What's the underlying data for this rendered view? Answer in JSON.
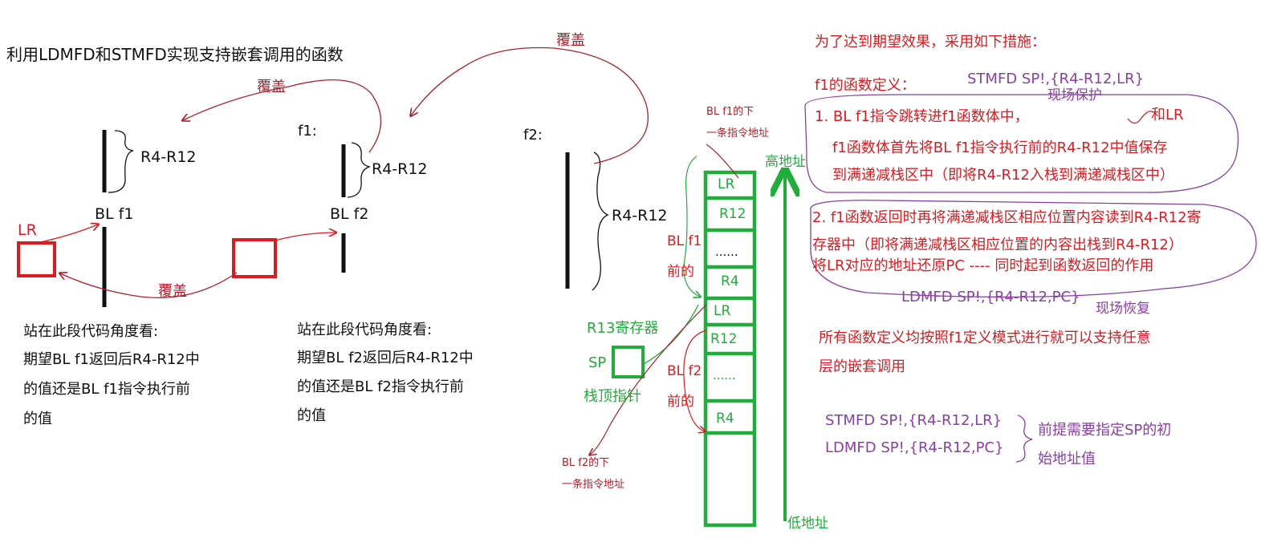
{
  "title": "利用LDMFD和STMFD实现支持嵌套调用的函数",
  "part1": {
    "regs": "R4-R12",
    "call": "BL f1",
    "lr": "LR",
    "cover_top": "覆盖",
    "cover_bottom": "覆盖",
    "note": [
      "站在此段代码角度看:",
      "期望BL f1返回后R4-R12中",
      "的值还是BL f1指令执行前",
      "的值"
    ]
  },
  "part2": {
    "label": "f1:",
    "regs": "R4-R12",
    "call": "BL f2",
    "cover_top": "覆盖",
    "note": [
      "站在此段代码角度看:",
      "期望BL f2返回后R4-R12中",
      "的值还是BL f2指令执行前",
      "的值"
    ]
  },
  "part3": {
    "label": "f2:",
    "regs": "R4-R12"
  },
  "stack": {
    "cells": [
      "LR",
      "R12",
      "......",
      "R4",
      "LR",
      "R12",
      "......",
      "R4"
    ],
    "high_addr": "高地址",
    "low_addr": "低地址",
    "next_f1": [
      "BL f1的下",
      "一条指令地址"
    ],
    "next_f2": [
      "BL f2的下",
      "一条指令地址"
    ],
    "before_f1": [
      "BL f1",
      "前的"
    ],
    "before_f2": [
      "BL f2",
      "前的"
    ],
    "r13": "R13寄存器",
    "sp": "SP",
    "sp_desc": "栈顶指针"
  },
  "notes": {
    "heading": "为了达到期望效果，采用如下措施：",
    "f1_def": "f1的函数定义：",
    "stmfd": "STMFD SP!,{R4-R12,LR}",
    "scene_save": "现场保护",
    "step1": [
      "1. BL f1指令跳转进f1函数体中，",
      "和LR",
      "f1函数体首先将BL f1指令执行前的R4-R12中值保存",
      "到满递减栈区中（即将R4-R12入栈到满递减栈区中）"
    ],
    "step2": [
      "2. f1函数返回时再将满递减栈区相应位置内容读到R4-R12寄",
      "存器中（即将满递减栈区相应位置的内容出栈到R4-R12）",
      "将LR对应的地址还原PC ---- 同时起到函数返回的作用"
    ],
    "ldmfd": "LDMFD SP!,{R4-R12,PC}",
    "scene_restore": "现场恢复",
    "all_funcs": [
      "所有函数定义均按照f1定义模式进行就可以支持任意",
      "层的嵌套调用"
    ],
    "summary_stm": "STMFD SP!,{R4-R12,LR}",
    "summary_ldm": "LDMFD SP!,{R4-R12,PC}",
    "summary_note": [
      "前提需要指定SP的初",
      "始地址值"
    ]
  },
  "colors": {
    "red": "#e0191e",
    "dark_red": "#b01e2a",
    "green": "#1fae3a",
    "purple": "#8a3ea6",
    "black": "#111111"
  }
}
